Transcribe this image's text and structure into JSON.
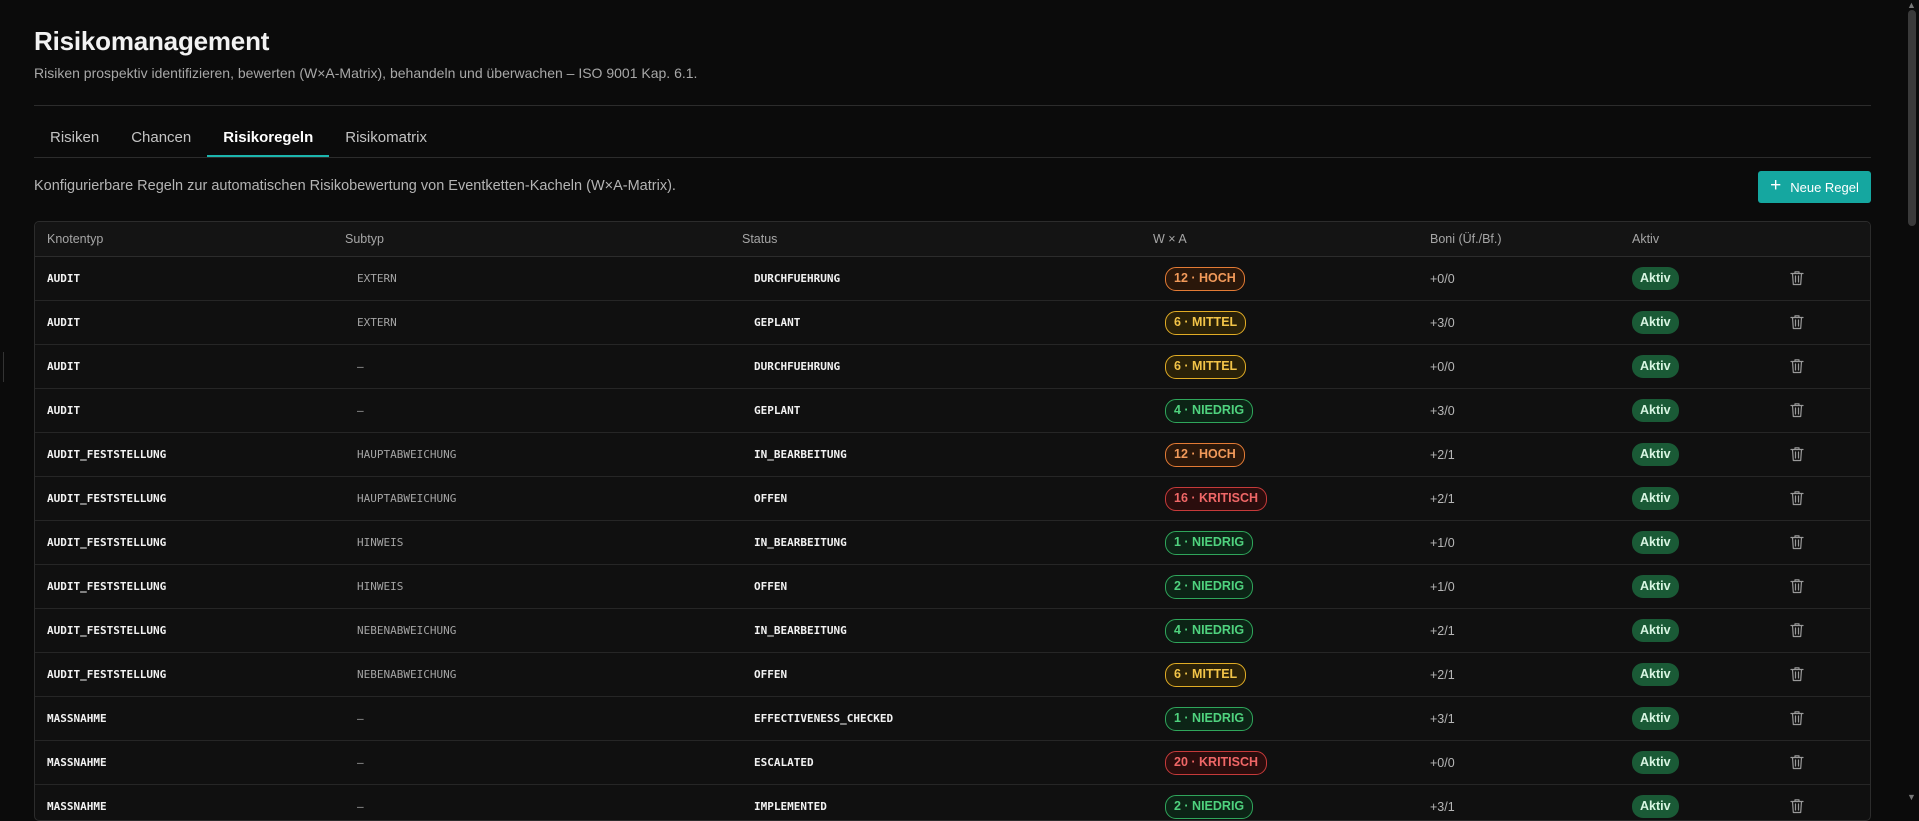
{
  "page": {
    "title": "Risikomanagement",
    "subtitle": "Risiken prospektiv identifizieren, bewerten (W×A-Matrix), behandeln und überwachen – ISO 9001 Kap. 6.1."
  },
  "tabs": [
    {
      "label": "Risiken",
      "active": false
    },
    {
      "label": "Chancen",
      "active": false
    },
    {
      "label": "Risikoregeln",
      "active": true
    },
    {
      "label": "Risikomatrix",
      "active": false
    }
  ],
  "info_text": "Konfigurierbare Regeln zur automatischen Risikobewertung von Eventketten-Kacheln (W×A-Matrix).",
  "new_rule_button": {
    "label": "Neue Regel",
    "icon": "plus-icon"
  },
  "table": {
    "headers": [
      "Knotentyp",
      "Subtyp",
      "Status",
      "W × A",
      "Boni (Üf./Bf.)",
      "Aktiv"
    ],
    "rows": [
      {
        "knotentyp": "AUDIT",
        "subtyp": "EXTERN",
        "status": "DURCHFUEHRUNG",
        "score": "12 · HOCH",
        "level": "hoch",
        "boni": "+0/0",
        "aktiv": "Aktiv"
      },
      {
        "knotentyp": "AUDIT",
        "subtyp": "EXTERN",
        "status": "GEPLANT",
        "score": "6 · MITTEL",
        "level": "mittel",
        "boni": "+3/0",
        "aktiv": "Aktiv"
      },
      {
        "knotentyp": "AUDIT",
        "subtyp": "—",
        "status": "DURCHFUEHRUNG",
        "score": "6 · MITTEL",
        "level": "mittel",
        "boni": "+0/0",
        "aktiv": "Aktiv"
      },
      {
        "knotentyp": "AUDIT",
        "subtyp": "—",
        "status": "GEPLANT",
        "score": "4 · NIEDRIG",
        "level": "niedrig",
        "boni": "+3/0",
        "aktiv": "Aktiv"
      },
      {
        "knotentyp": "AUDIT_FESTSTELLUNG",
        "subtyp": "HAUPTABWEICHUNG",
        "status": "IN_BEARBEITUNG",
        "score": "12 · HOCH",
        "level": "hoch",
        "boni": "+2/1",
        "aktiv": "Aktiv"
      },
      {
        "knotentyp": "AUDIT_FESTSTELLUNG",
        "subtyp": "HAUPTABWEICHUNG",
        "status": "OFFEN",
        "score": "16 · KRITISCH",
        "level": "kritisch",
        "boni": "+2/1",
        "aktiv": "Aktiv"
      },
      {
        "knotentyp": "AUDIT_FESTSTELLUNG",
        "subtyp": "HINWEIS",
        "status": "IN_BEARBEITUNG",
        "score": "1 · NIEDRIG",
        "level": "niedrig",
        "boni": "+1/0",
        "aktiv": "Aktiv"
      },
      {
        "knotentyp": "AUDIT_FESTSTELLUNG",
        "subtyp": "HINWEIS",
        "status": "OFFEN",
        "score": "2 · NIEDRIG",
        "level": "niedrig",
        "boni": "+1/0",
        "aktiv": "Aktiv"
      },
      {
        "knotentyp": "AUDIT_FESTSTELLUNG",
        "subtyp": "NEBENABWEICHUNG",
        "status": "IN_BEARBEITUNG",
        "score": "4 · NIEDRIG",
        "level": "niedrig",
        "boni": "+2/1",
        "aktiv": "Aktiv"
      },
      {
        "knotentyp": "AUDIT_FESTSTELLUNG",
        "subtyp": "NEBENABWEICHUNG",
        "status": "OFFEN",
        "score": "6 · MITTEL",
        "level": "mittel",
        "boni": "+2/1",
        "aktiv": "Aktiv"
      },
      {
        "knotentyp": "MASSNAHME",
        "subtyp": "—",
        "status": "EFFECTIVENESS_CHECKED",
        "score": "1 · NIEDRIG",
        "level": "niedrig",
        "boni": "+3/1",
        "aktiv": "Aktiv"
      },
      {
        "knotentyp": "MASSNAHME",
        "subtyp": "—",
        "status": "ESCALATED",
        "score": "20 · KRITISCH",
        "level": "kritisch",
        "boni": "+0/0",
        "aktiv": "Aktiv"
      },
      {
        "knotentyp": "MASSNAHME",
        "subtyp": "—",
        "status": "IMPLEMENTED",
        "score": "2 · NIEDRIG",
        "level": "niedrig",
        "boni": "+3/1",
        "aktiv": "Aktiv"
      }
    ]
  },
  "colors": {
    "accent": "#15a7a0",
    "hoch": "#f29a5a",
    "mittel": "#f2c448",
    "niedrig": "#4fd27e",
    "kritisch": "#f06767",
    "aktiv_bg": "#1a5a36"
  }
}
